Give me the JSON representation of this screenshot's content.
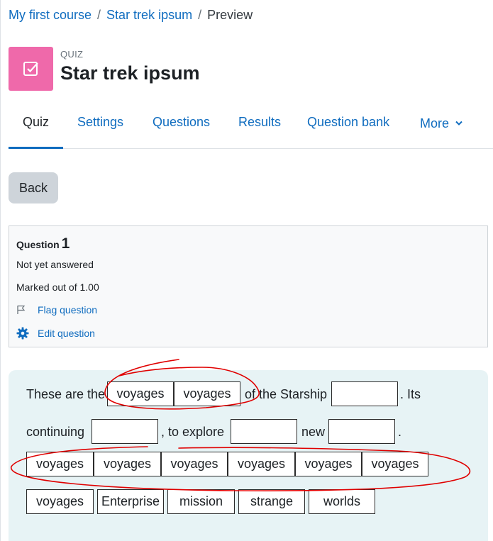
{
  "breadcrumb": {
    "course": "My first course",
    "quiz": "Star trek ipsum",
    "current": "Preview",
    "separator": "/"
  },
  "header": {
    "module_label": "QUIZ",
    "title": "Star trek ipsum",
    "icon": "quiz-checkbox-icon",
    "icon_color": "#ef69aa"
  },
  "tabs": [
    {
      "label": "Quiz",
      "active": true
    },
    {
      "label": "Settings"
    },
    {
      "label": "Questions"
    },
    {
      "label": "Results"
    },
    {
      "label": "Question bank"
    },
    {
      "label": "More",
      "icon": "chevron-down-icon"
    }
  ],
  "back_label": "Back",
  "question_info": {
    "label": "Question",
    "number": "1",
    "state": "Not yet answered",
    "marks": "Marked out of 1.00",
    "flag_link": "Flag question",
    "flag_icon": "flag-icon",
    "edit_link": "Edit question",
    "edit_icon": "gear-icon"
  },
  "question": {
    "segments": [
      "These are the",
      "of the Starship",
      ". Its",
      "continuing",
      ", to explore",
      "new",
      "."
    ],
    "placed_items": [
      "voyages",
      "voyages"
    ],
    "drag_items_row1": [
      "voyages",
      "voyages",
      "voyages",
      "voyages",
      "voyages",
      "voyages"
    ],
    "drag_items_row2": [
      "voyages",
      "Enterprise",
      "mission",
      "strange",
      "worlds"
    ]
  },
  "colors": {
    "link": "#0f6cbf",
    "content_bg": "#e7f3f5",
    "annotation": "#e00000"
  }
}
